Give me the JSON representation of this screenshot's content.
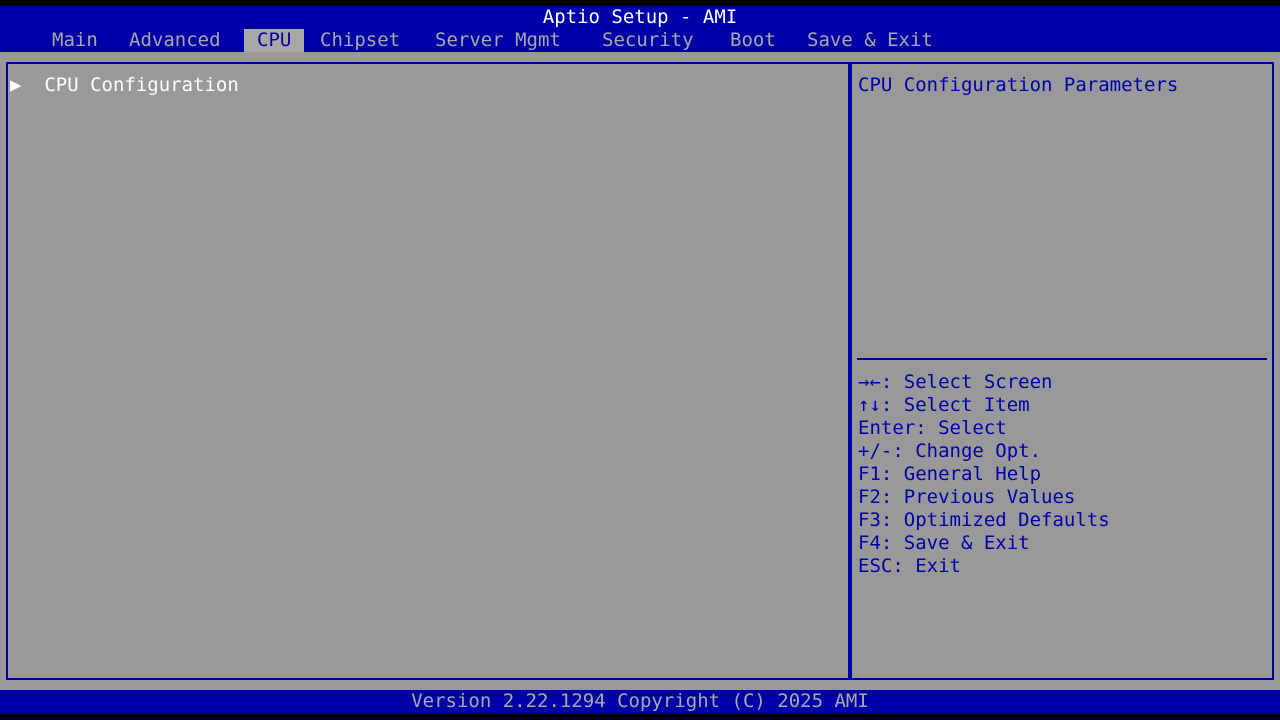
{
  "header": {
    "title": "Aptio Setup - AMI",
    "tabs": [
      {
        "label": "Main",
        "active": false
      },
      {
        "label": "Advanced",
        "active": false
      },
      {
        "label": "CPU",
        "active": true
      },
      {
        "label": "Chipset",
        "active": false
      },
      {
        "label": "Server Mgmt",
        "active": false
      },
      {
        "label": "Security",
        "active": false
      },
      {
        "label": "Boot",
        "active": false
      },
      {
        "label": "Save & Exit",
        "active": false
      }
    ]
  },
  "main": {
    "items": [
      {
        "marker": "▶",
        "label": "CPU Configuration",
        "type": "submenu"
      }
    ]
  },
  "help": {
    "description": "CPU Configuration Parameters",
    "keys": [
      "→←: Select Screen",
      "↑↓: Select Item",
      "Enter: Select",
      "+/-: Change Opt.",
      "F1: General Help",
      "F2: Previous Values",
      "F3: Optimized Defaults",
      "F4: Save & Exit",
      "ESC: Exit"
    ]
  },
  "footer": {
    "version": "Version 2.22.1294 Copyright (C) 2025 AMI"
  },
  "colors": {
    "bar_blue": "#0000a8",
    "panel_gray": "#999999",
    "tab_text": "#a8a8a8",
    "highlight_text": "#ffffff"
  }
}
